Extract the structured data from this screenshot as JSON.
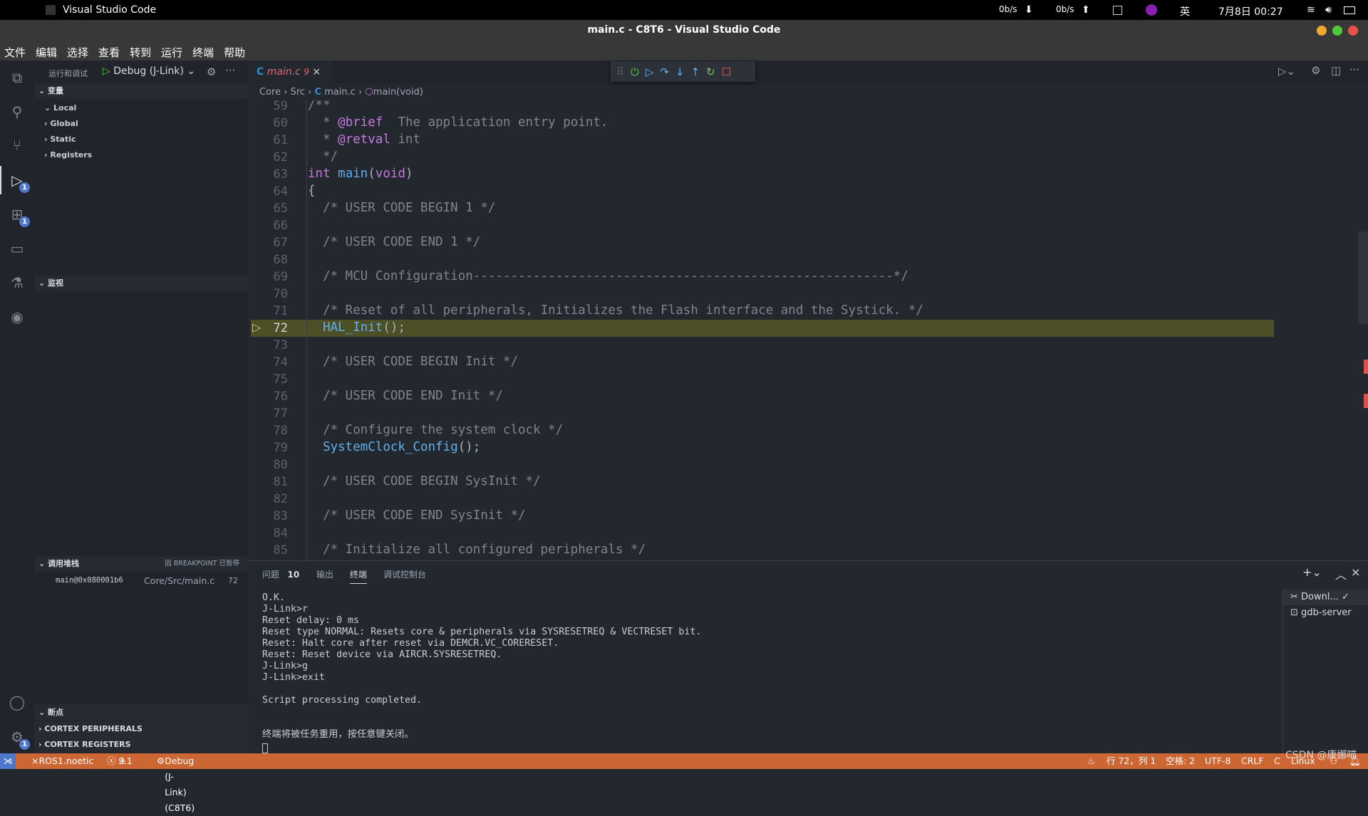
{
  "system_bar": {
    "app_name": "Visual Studio Code",
    "net_down": "0b/s",
    "net_up": "0b/s",
    "input_method": "英",
    "datetime": "7月8日  00:27"
  },
  "window": {
    "title": "main.c - C8T6 - Visual Studio Code",
    "colors": {
      "minimize": "#f0a830",
      "maximize": "#4fc83c",
      "close": "#e8504a"
    }
  },
  "menu": [
    "文件",
    "编辑",
    "选择",
    "查看",
    "转到",
    "运行",
    "终端",
    "帮助"
  ],
  "activity_bar": {
    "debug_badge": "1",
    "extensions_badge": "1",
    "settings_badge": "1"
  },
  "sidebar": {
    "title": "运行和调试",
    "config": "Debug (J-Link)",
    "variables": {
      "header": "变量",
      "items": [
        "Local",
        "Global",
        "Static",
        "Registers"
      ]
    },
    "watch": {
      "header": "监视"
    },
    "call_stack": {
      "header": "调用堆栈",
      "status": "因 BREAKPOINT 已暂停",
      "frame": {
        "name": "main@0x080001b6",
        "file": "Core/Src/main.c",
        "line": "72"
      }
    },
    "breakpoints": {
      "header": "断点"
    },
    "cortex_peripherals": "CORTEX PERIPHERALS",
    "cortex_registers": "CORTEX REGISTERS"
  },
  "editor": {
    "tab": {
      "name": "main.c",
      "problems": "9"
    },
    "breadcrumb": [
      "Core",
      "Src",
      "main.c",
      "main(void)"
    ],
    "current_line": 72,
    "lines": [
      {
        "n": "59",
        "tokens": [
          [
            "/**",
            "cm"
          ]
        ]
      },
      {
        "n": "60",
        "tokens": [
          [
            "  * ",
            "cm"
          ],
          [
            "@brief",
            "kw"
          ],
          [
            "  The application entry point.",
            "cm"
          ]
        ]
      },
      {
        "n": "61",
        "tokens": [
          [
            "  * ",
            "cm"
          ],
          [
            "@retval",
            "kw"
          ],
          [
            " int",
            "cm"
          ]
        ]
      },
      {
        "n": "62",
        "tokens": [
          [
            "  */",
            "cm"
          ]
        ]
      },
      {
        "n": "63",
        "tokens": [
          [
            "int ",
            "kw"
          ],
          [
            "main",
            "fn"
          ],
          [
            "(",
            "pl"
          ],
          [
            "void",
            "kw"
          ],
          [
            ")",
            "pl"
          ]
        ]
      },
      {
        "n": "64",
        "tokens": [
          [
            "{",
            "pl"
          ]
        ]
      },
      {
        "n": "65",
        "tokens": [
          [
            "  /* USER CODE BEGIN 1 */",
            "cm"
          ]
        ]
      },
      {
        "n": "66",
        "tokens": []
      },
      {
        "n": "67",
        "tokens": [
          [
            "  /* USER CODE END 1 */",
            "cm"
          ]
        ]
      },
      {
        "n": "68",
        "tokens": []
      },
      {
        "n": "69",
        "tokens": [
          [
            "  /* MCU Configuration--------------------------------------------------------*/",
            "cm"
          ]
        ]
      },
      {
        "n": "70",
        "tokens": []
      },
      {
        "n": "71",
        "tokens": [
          [
            "  /* Reset of all peripherals, Initializes the Flash interface and the Systick. */",
            "cm"
          ]
        ]
      },
      {
        "n": "72",
        "tokens": [
          [
            "  ",
            "pl"
          ],
          [
            "HAL_Init",
            "fn"
          ],
          [
            "();",
            "pl"
          ]
        ]
      },
      {
        "n": "73",
        "tokens": []
      },
      {
        "n": "74",
        "tokens": [
          [
            "  /* USER CODE BEGIN Init */",
            "cm"
          ]
        ]
      },
      {
        "n": "75",
        "tokens": []
      },
      {
        "n": "76",
        "tokens": [
          [
            "  /* USER CODE END Init */",
            "cm"
          ]
        ]
      },
      {
        "n": "77",
        "tokens": []
      },
      {
        "n": "78",
        "tokens": [
          [
            "  /* Configure the system clock */",
            "cm"
          ]
        ]
      },
      {
        "n": "79",
        "tokens": [
          [
            "  ",
            "pl"
          ],
          [
            "SystemClock_Config",
            "fn"
          ],
          [
            "();",
            "pl"
          ]
        ]
      },
      {
        "n": "80",
        "tokens": []
      },
      {
        "n": "81",
        "tokens": [
          [
            "  /* USER CODE BEGIN SysInit */",
            "cm"
          ]
        ]
      },
      {
        "n": "82",
        "tokens": []
      },
      {
        "n": "83",
        "tokens": [
          [
            "  /* USER CODE END SysInit */",
            "cm"
          ]
        ]
      },
      {
        "n": "84",
        "tokens": []
      },
      {
        "n": "85",
        "tokens": [
          [
            "  /* Initialize all configured peripherals */",
            "cm"
          ]
        ]
      }
    ]
  },
  "panel": {
    "tabs": [
      {
        "label": "问题",
        "count": "10"
      },
      {
        "label": "输出"
      },
      {
        "label": "终端",
        "active": true
      },
      {
        "label": "调试控制台"
      }
    ],
    "terminal": "O.K.\nJ-Link>r\nReset delay: 0 ms\nReset type NORMAL: Resets core & peripherals via SYSRESETREQ & VECTRESET bit.\nReset: Halt core after reset via DEMCR.VC_CORERESET.\nReset: Reset device via AIRCR.SYSRESETREQ.\nJ-Link>g\nJ-Link>exit\n\nScript processing completed.\n\n\n终端将被任务重用，按任意键关闭。",
    "terminals": [
      "Downl...",
      "gdb-server"
    ]
  },
  "status_bar": {
    "remote": "ROS1.noetic",
    "errors": "9",
    "warnings": "1",
    "debug": "Debug (J-Link) (C8T6)",
    "position": "行 72，列 1",
    "spaces": "空格: 2",
    "encoding": "UTF-8",
    "eol": "CRLF",
    "language": "C",
    "platform": "Linux",
    "watermark": "CSDN @康娜喵",
    "color": "#cc6633"
  }
}
